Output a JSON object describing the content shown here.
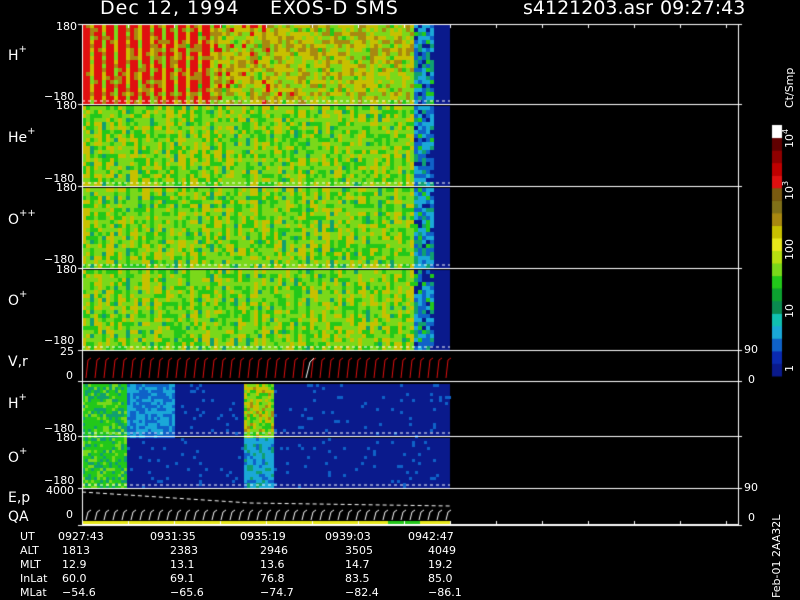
{
  "header": {
    "date": "Dec 12, 1994",
    "instrument": "EXOS-D SMS",
    "file": "s4121203.asr",
    "time": "09:27:43"
  },
  "panels": [
    {
      "label": "H",
      "sup": "+",
      "ytop": "180",
      "ybot": "−180"
    },
    {
      "label": "He",
      "sup": "+",
      "ytop": "180",
      "ybot": "−180"
    },
    {
      "label": "O",
      "sup": "++",
      "ytop": "180",
      "ybot": "−180"
    },
    {
      "label": "O",
      "sup": "+",
      "ytop": "180",
      "ybot": "−180"
    },
    {
      "label": "V,r",
      "sup": "",
      "ytop": "25",
      "ybot": "0",
      "rtop": "90",
      "rbot": "0"
    },
    {
      "label": "H",
      "sup": "+",
      "ytop": "",
      "ybot": "−180"
    },
    {
      "label": "O",
      "sup": "+",
      "ytop": "180",
      "ybot": "−180"
    },
    {
      "label": "E,p",
      "label2": "QA",
      "ytop": "4000",
      "ybot": "0",
      "rtop": "90",
      "rbot": "0"
    }
  ],
  "colorbar": {
    "unit": "Ct/Smp",
    "ticks": {
      "t1": "1",
      "t10": "10",
      "t100": "100",
      "t1000": "10",
      "t1000_sup": "3",
      "t10000": "10",
      "t10000_sup": "4"
    },
    "colors": [
      "#0a1a8c",
      "#0a2ab0",
      "#0f62c8",
      "#1aa8d8",
      "#10c0b0",
      "#0a8a50",
      "#0ca030",
      "#22c81a",
      "#7ad81a",
      "#b8e010",
      "#e8e81a",
      "#c8c000",
      "#a88810",
      "#807018",
      "#7a5a10",
      "#e01010",
      "#c00000",
      "#900000",
      "#600000",
      "#ffffff"
    ]
  },
  "footer": {
    "labels": [
      "UT",
      "ALT",
      "MLT",
      "InLat",
      "MLat"
    ],
    "columns": [
      [
        "0927:43",
        "1813",
        "12.9",
        "60.0",
        "−54.6"
      ],
      [
        "0931:35",
        "2383",
        "13.1",
        "69.1",
        "−65.6"
      ],
      [
        "0935:19",
        "2946",
        "13.6",
        "76.8",
        "−74.7"
      ],
      [
        "0939:03",
        "3505",
        "14.7",
        "83.5",
        "−82.4"
      ],
      [
        "0942:47",
        "4049",
        "19.2",
        "85.0",
        "−86.1"
      ]
    ],
    "stamp": "Feb-01 2AA32L"
  },
  "chart_data": {
    "type": "heatmap",
    "x_axis": "UT",
    "x_ticks": [
      "0927:43",
      "0931:35",
      "0935:19",
      "0939:03",
      "0942:47"
    ],
    "panels": [
      {
        "name": "H+",
        "ylim": [
          -180,
          180
        ],
        "data_end_fraction": 0.86
      },
      {
        "name": "He+",
        "ylim": [
          -180,
          180
        ],
        "data_end_fraction": 0.86
      },
      {
        "name": "O++",
        "ylim": [
          -180,
          180
        ],
        "data_end_fraction": 0.86
      },
      {
        "name": "O+",
        "ylim": [
          -180,
          180
        ],
        "data_end_fraction": 0.86
      },
      {
        "name": "V,r",
        "ylim": [
          0,
          25
        ],
        "right_ylim": [
          0,
          90
        ]
      },
      {
        "name": "H+",
        "ylim": [
          -180,
          180
        ]
      },
      {
        "name": "O+",
        "ylim": [
          -180,
          180
        ]
      },
      {
        "name": "E,p / QA",
        "ylim": [
          0,
          4000
        ],
        "right_ylim": [
          0,
          90
        ]
      }
    ],
    "colorbar_scale": "log",
    "colorbar_range": [
      1,
      10000
    ],
    "colorbar_unit": "Ct/Smp"
  }
}
